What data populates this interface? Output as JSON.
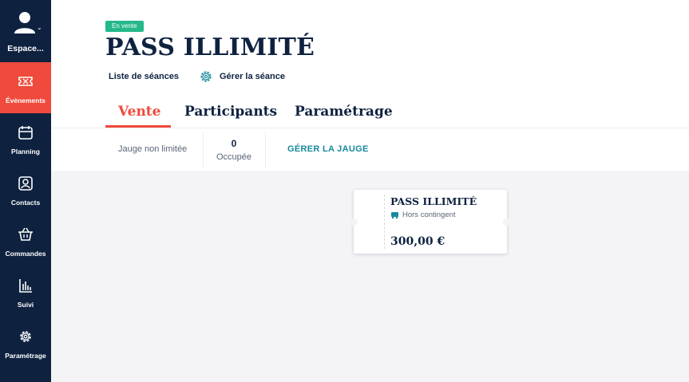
{
  "sidebar": {
    "space_label": "Espace...",
    "items": [
      {
        "label": "Évènements",
        "icon": "ticket-icon",
        "active": true
      },
      {
        "label": "Planning",
        "icon": "calendar-icon",
        "active": false
      },
      {
        "label": "Contacts",
        "icon": "contact-card-icon",
        "active": false
      },
      {
        "label": "Commandes",
        "icon": "basket-icon",
        "active": false
      },
      {
        "label": "Suivi",
        "icon": "bar-chart-icon",
        "active": false
      },
      {
        "label": "Paramétrage",
        "icon": "gear-icon",
        "active": false
      }
    ]
  },
  "header": {
    "status_badge": "En vente",
    "title": "PASS ILLIMITÉ",
    "session_list_link": "Liste de séances",
    "manage_session_link": "Gérer la séance"
  },
  "tabs": [
    {
      "label": "Vente",
      "active": true
    },
    {
      "label": "Participants",
      "active": false
    },
    {
      "label": "Paramétrage",
      "active": false
    }
  ],
  "gauge": {
    "label": "Jauge non limitée",
    "occupied_count": "0",
    "occupied_label": "Occupée",
    "manage_link": "GÉRER LA JAUGE"
  },
  "ticket": {
    "name": "PASS ILLIMITÉ",
    "quota": "Hors contingent",
    "price": "300,00 €"
  },
  "colors": {
    "sidebar_bg": "#0e2240",
    "accent_red": "#ef4a3b",
    "badge_green": "#24b88a",
    "link_teal": "#16899e",
    "content_bg": "#f4f4f7"
  }
}
